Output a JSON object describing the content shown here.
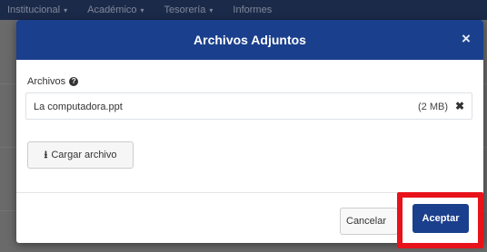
{
  "app_nav": {
    "items": [
      {
        "label": "Institucional"
      },
      {
        "label": "Académico"
      },
      {
        "label": "Tesorería"
      },
      {
        "label": "Informes"
      }
    ]
  },
  "modal": {
    "title": "Archivos Adjuntos",
    "close_label": "×",
    "section_label": "Archivos",
    "help_icon": "question-circle-icon",
    "files": [
      {
        "name": "La computadora.ppt",
        "size": "(2 MB)",
        "remove_label": "✖"
      }
    ],
    "upload_label": "Cargar archivo",
    "cancel_label": "Cancelar",
    "accept_label": "Aceptar"
  },
  "colors": {
    "header_bg": "#1a3f8c",
    "accept_bg": "#1a3f8c",
    "highlight": "#e8121b"
  }
}
